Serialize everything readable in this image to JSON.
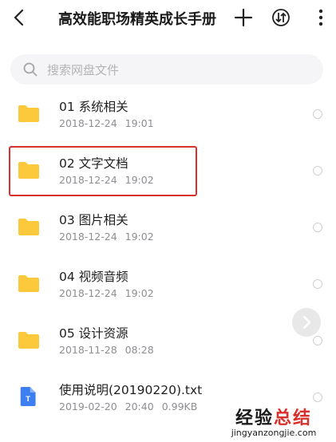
{
  "header": {
    "title": "高效能职场精英成长手册"
  },
  "search": {
    "placeholder": "搜索网盘文件"
  },
  "files": [
    {
      "name": "01 系统相关",
      "date": "2018-12-24",
      "time": "19:01",
      "size": "",
      "type": "folder"
    },
    {
      "name": "02 文字文档",
      "date": "2018-12-24",
      "time": "19:02",
      "size": "",
      "type": "folder"
    },
    {
      "name": "03 图片相关",
      "date": "2018-12-24",
      "time": "19:02",
      "size": "",
      "type": "folder"
    },
    {
      "name": "04 视频音频",
      "date": "2018-12-24",
      "time": "19:02",
      "size": "",
      "type": "folder"
    },
    {
      "name": "05 设计资源",
      "date": "2018-11-28",
      "time": "08:28",
      "size": "",
      "type": "folder"
    },
    {
      "name": "使用说明(20190220).txt",
      "date": "2019-02-20",
      "time": "20:40",
      "size": "0.99KB",
      "type": "txt"
    }
  ],
  "icons": {
    "folder_color": "#fbc93b",
    "txt_color": "#3d7ef0",
    "txt_glyph": "T"
  },
  "watermark": {
    "line1_a": "经验",
    "line1_b": "总结",
    "line2": "jingyanzongjie.com"
  },
  "colors": {
    "highlight": "#d9302c",
    "meta_text": "#8e8e93"
  }
}
